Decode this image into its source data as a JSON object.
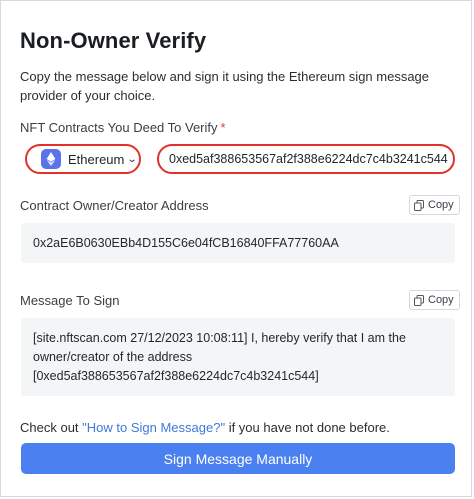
{
  "title": "Non-Owner Verify",
  "description": "Copy the message below and sign it using the Ethereum sign message provider of your choice.",
  "contracts_field": {
    "label": "NFT Contracts You Deed To Verify",
    "required_mark": "*",
    "chain": "Ethereum",
    "contract_address": "0xed5af388653567af2f388e6224dc7c4b3241c544"
  },
  "owner_field": {
    "label": "Contract Owner/Creator Address",
    "copy_label": "Copy",
    "value": "0x2aE6B0630EBb4D155C6e04fCB16840FFA77760AA"
  },
  "message_field": {
    "label": "Message To Sign",
    "copy_label": "Copy",
    "value": "[site.nftscan.com 27/12/2023 10:08:11] I, hereby verify that I am the owner/creator of the address [0xed5af388653567af2f388e6224dc7c4b3241c544]"
  },
  "footer": {
    "prefix": "Check out ",
    "link": "\"How to Sign Message?\"",
    "suffix": " if you have not done before."
  },
  "sign_button_label": "Sign Message Manually",
  "colors": {
    "accent": "#4a80f0",
    "highlight_border": "#e0322b",
    "link": "#3f79d9",
    "ethereum_badge": "#5b73e8"
  }
}
